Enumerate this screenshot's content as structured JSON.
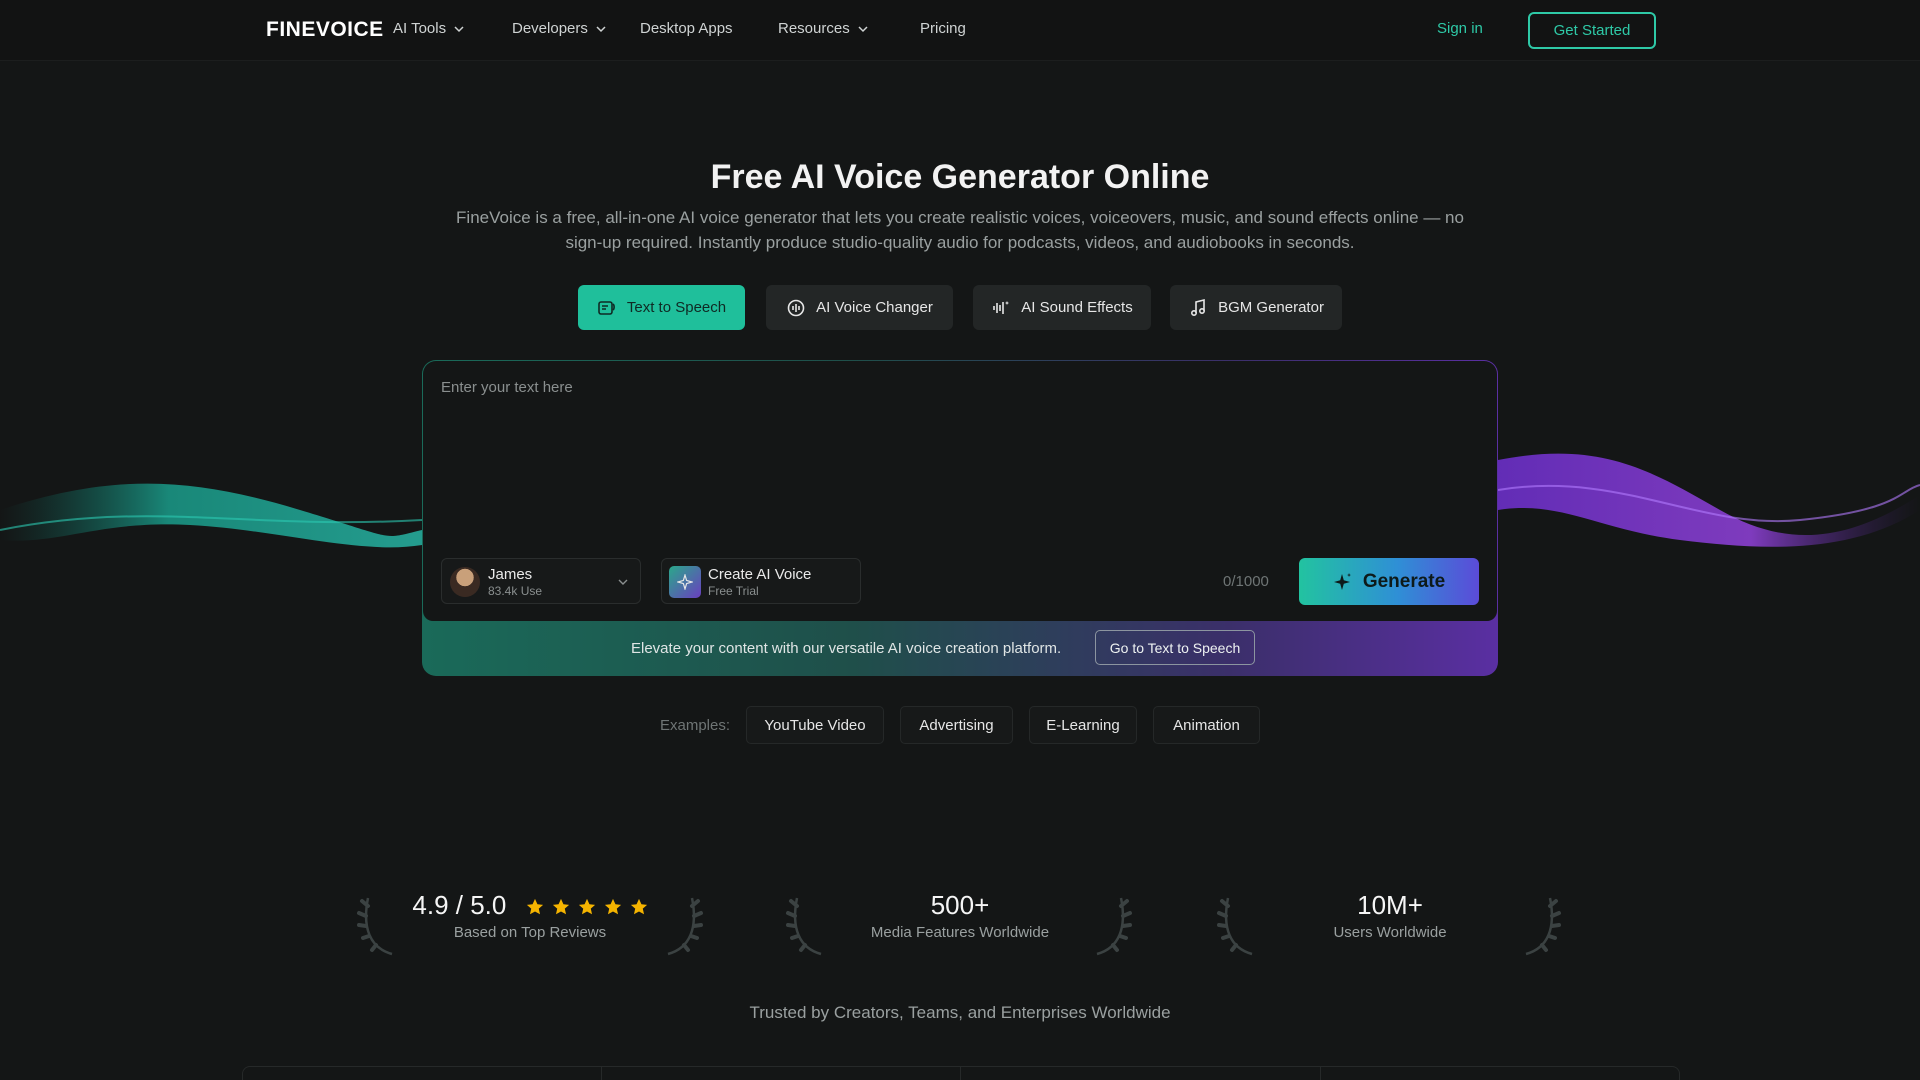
{
  "nav": {
    "logo": "FINEVOICE",
    "items": [
      {
        "label": "AI Tools",
        "dropdown": true
      },
      {
        "label": "Developers",
        "dropdown": true
      },
      {
        "label": "Desktop Apps",
        "dropdown": false
      },
      {
        "label": "Resources",
        "dropdown": true
      },
      {
        "label": "Pricing",
        "dropdown": false
      }
    ],
    "sign_in": "Sign in",
    "get_started": "Get Started"
  },
  "hero": {
    "title": "Free AI Voice Generator Online",
    "subtitle_line1": "FineVoice is a free, all-in-one AI voice generator that lets you create realistic voices, voiceovers, music, and sound effects online — no",
    "subtitle_line2": "sign-up required. Instantly produce studio-quality audio for podcasts, videos, and audiobooks in seconds."
  },
  "tabs": [
    {
      "label": "Text to Speech",
      "icon": "text-to-speech-icon",
      "active": true
    },
    {
      "label": "AI Voice Changer",
      "icon": "voice-changer-icon",
      "active": false
    },
    {
      "label": "AI Sound Effects",
      "icon": "sound-effects-icon",
      "active": false
    },
    {
      "label": "BGM Generator",
      "icon": "music-note-icon",
      "active": false
    }
  ],
  "editor": {
    "placeholder": "Enter your text here",
    "voice": {
      "name": "James",
      "uses": "83.4k Use"
    },
    "create_voice": {
      "title": "Create AI Voice",
      "subtitle": "Free Trial"
    },
    "counter": "0/1000",
    "generate": "Generate",
    "promo_text": "Elevate your content with our versatile AI voice creation platform.",
    "promo_button": "Go to Text to Speech"
  },
  "examples": {
    "label": "Examples:",
    "chips": [
      "YouTube Video",
      "Advertising",
      "E-Learning",
      "Animation"
    ]
  },
  "stats": [
    {
      "value": "4.9 / 5.0",
      "label": "Based on Top Reviews",
      "stars": 5
    },
    {
      "value": "500+",
      "label": "Media Features Worldwide"
    },
    {
      "value": "10M+",
      "label": "Users Worldwide"
    }
  ],
  "trusted": "Trusted by Creators, Teams, and Enterprises Worldwide",
  "colors": {
    "accent": "#1fbf9b",
    "background": "#141616",
    "star": "#f5b400",
    "purple": "#6a3fc0"
  }
}
